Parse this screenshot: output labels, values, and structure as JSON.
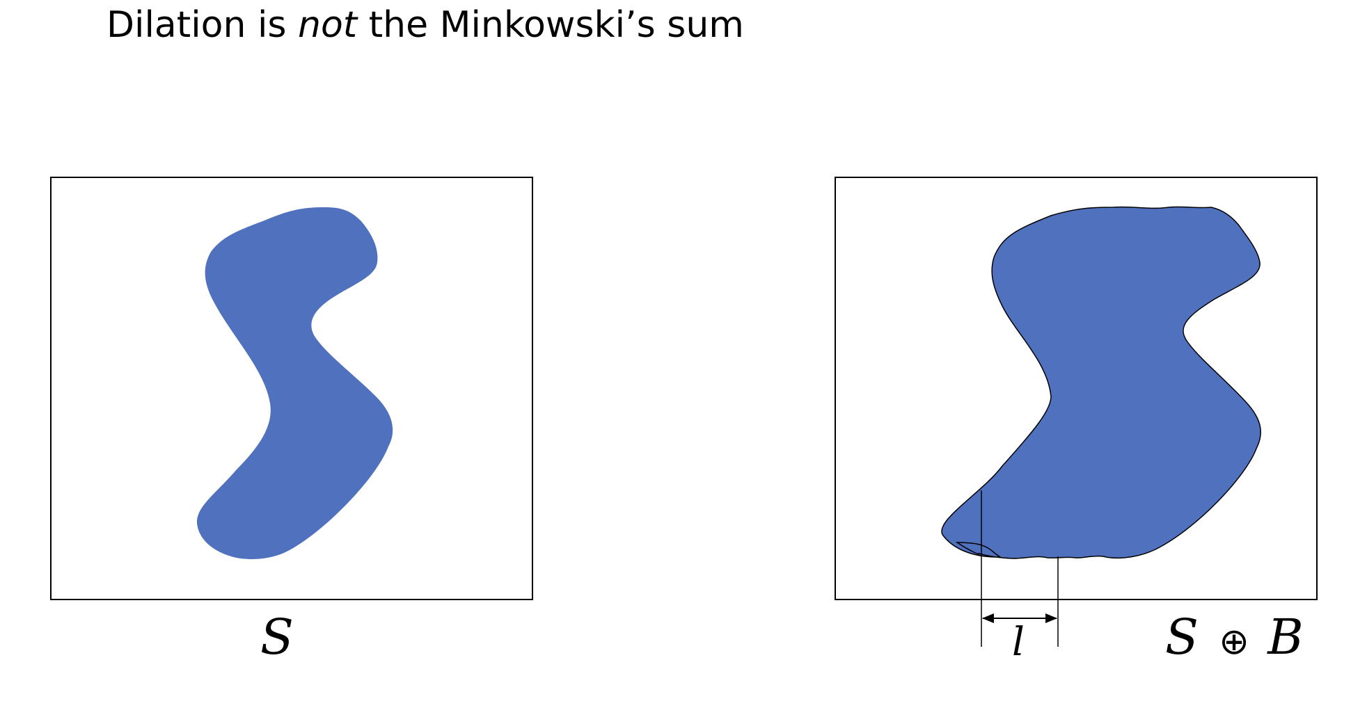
{
  "title": {
    "prefix": "Dilation is ",
    "emphasis": "not",
    "suffix": " the Minkowski’s sum"
  },
  "panels": [
    {
      "label": "S"
    },
    {
      "label_left": "S",
      "operator": "⊕",
      "label_right": "B",
      "dimension_label": "l"
    }
  ],
  "colors": {
    "shape_fill": "#4f71be",
    "frame_stroke": "#000000"
  }
}
